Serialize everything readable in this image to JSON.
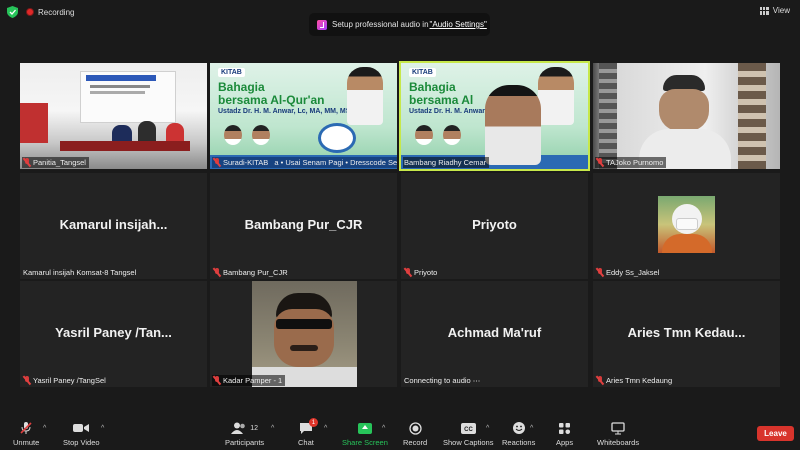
{
  "meeting": {
    "recording_label": "Recording",
    "view_label": "View",
    "audio_banner": {
      "text": "Setup professional audio in ",
      "link": "\"Audio Settings\""
    }
  },
  "tiles": [
    {
      "name": "Panitia_Tangsel",
      "muted": true,
      "video": true
    },
    {
      "name": "Suradi-KITAB",
      "name_suffix": "a • Usai Senam Pagi • Dresscode Senam Pagi",
      "muted": true,
      "video": true
    },
    {
      "name": "Bambang Riadhy Cemar",
      "muted": false,
      "video": true,
      "active": true
    },
    {
      "name": "TAJoko Purnomo",
      "muted": true,
      "video": true
    },
    {
      "name": "Kamarul insijah Komsat-8 Tangsel",
      "display": "Kamarul  insijah...",
      "muted": false,
      "video": false
    },
    {
      "name": "Bambang Pur_CJR",
      "display": "Bambang Pur_CJR",
      "muted": true,
      "video": false
    },
    {
      "name": "Priyoto",
      "display": "Priyoto",
      "muted": true,
      "video": false
    },
    {
      "name": "Eddy Ss_Jaksel",
      "muted": true,
      "video": true
    },
    {
      "name": "Yasril Paney /TangSel",
      "display": "Yasril Paney /Tan...",
      "muted": true,
      "video": false
    },
    {
      "name": "Kadar Pamper - 1",
      "muted": true,
      "video": true
    },
    {
      "name": "Connecting to audio ⋯",
      "display": "Achmad Ma'ruf",
      "muted": false,
      "video": false
    },
    {
      "name": "Aries Tmn Kedaung",
      "display": "Aries Tmn Kedau...",
      "muted": true,
      "video": false
    }
  ],
  "banner": {
    "logo": "KITAB",
    "title_line1": "Bahagia",
    "title_line2": "bersama Al-Qur'an",
    "speaker": "Ustadz Dr. H. M. Anwar, Lc, MA, MM, MSc",
    "speaker_short": "Ustadz Dr. H. M. Anwar, L... MSc",
    "title_line2_short": "bersama Al"
  },
  "toolbar": {
    "unmute": "Unmute",
    "stop_video": "Stop Video",
    "participants": "Participants",
    "participants_count": "12",
    "chat": "Chat",
    "chat_badge": "1",
    "share_screen": "Share Screen",
    "record": "Record",
    "show_captions": "Show Captions",
    "reactions": "Reactions",
    "apps": "Apps",
    "whiteboards": "Whiteboards",
    "leave": "Leave"
  },
  "colors": {
    "background": "#1a1a1a",
    "tile": "#232323",
    "active_border": "#c7e84a",
    "leave": "#d8342c",
    "share": "#27c45a",
    "muted": "#d43a3a"
  }
}
